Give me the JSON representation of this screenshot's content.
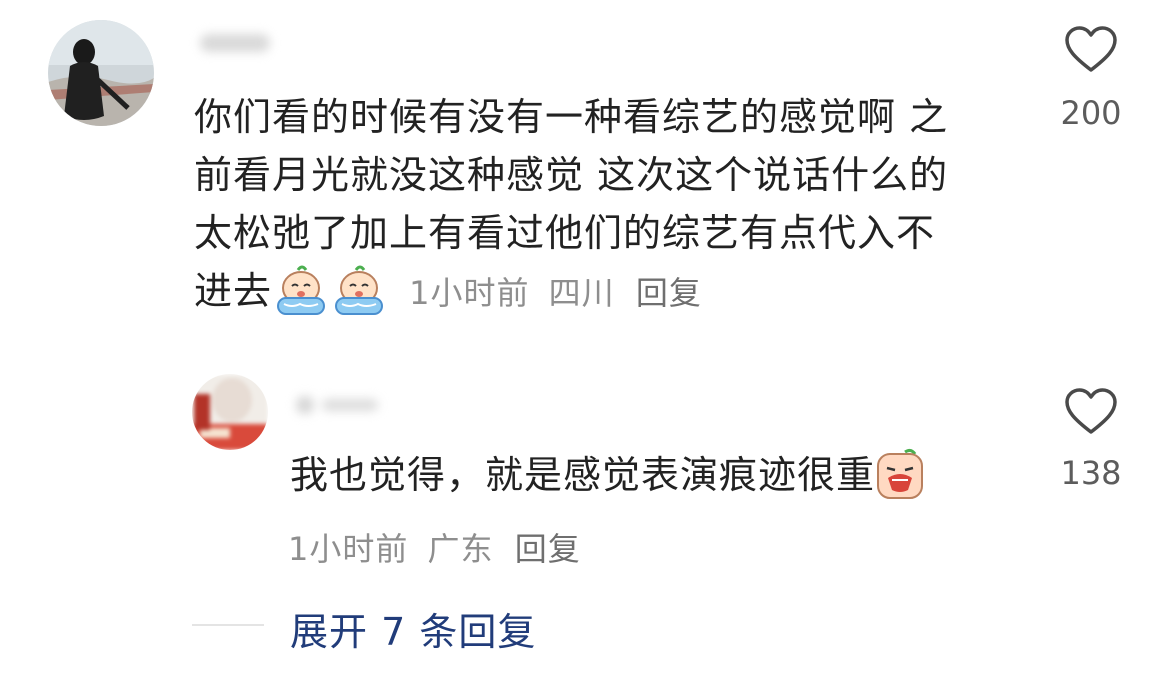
{
  "comment": {
    "text_line1": "你们看的时候有没有一种看综艺的感觉啊 之",
    "text_line2": "前看月光就没这种感觉 这次这个说话什么的",
    "text_line3": "太松弛了加上有看过他们的综艺有点代入不",
    "text_line4": "进去",
    "emoji": "crying-emoji",
    "time": "1小时前",
    "location": "四川",
    "reply_label": "回复",
    "likes": "200"
  },
  "reply": {
    "text": "我也觉得，就是感觉表演痕迹很重",
    "emoji": "crying-loud-emoji",
    "time": "1小时前",
    "location": "广东",
    "reply_label": "回复",
    "likes": "138"
  },
  "expand_label": "展开 7 条回复",
  "colors": {
    "text": "#222222",
    "meta": "#8e8e8e",
    "link": "#213c7a"
  }
}
